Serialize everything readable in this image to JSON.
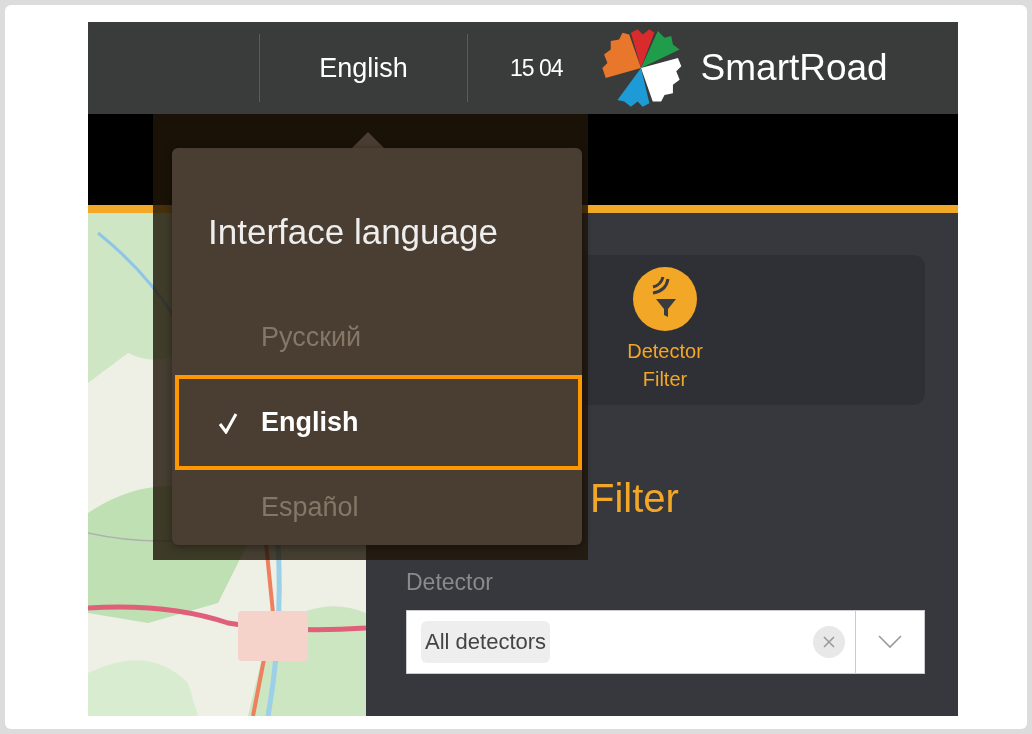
{
  "header": {
    "language": {
      "label": "English",
      "expanded": true
    },
    "time": "15 04",
    "app_name": "SmartRoad"
  },
  "language_menu": {
    "title": "Interface language",
    "items": [
      {
        "label": "Русский",
        "selected": false
      },
      {
        "label": "English",
        "selected": true
      },
      {
        "label": "Español",
        "selected": false
      }
    ]
  },
  "tools": [
    {
      "label": "Detector Filter"
    }
  ],
  "section_title": "Filter",
  "detector": {
    "label": "Detector",
    "value": "All detectors"
  }
}
